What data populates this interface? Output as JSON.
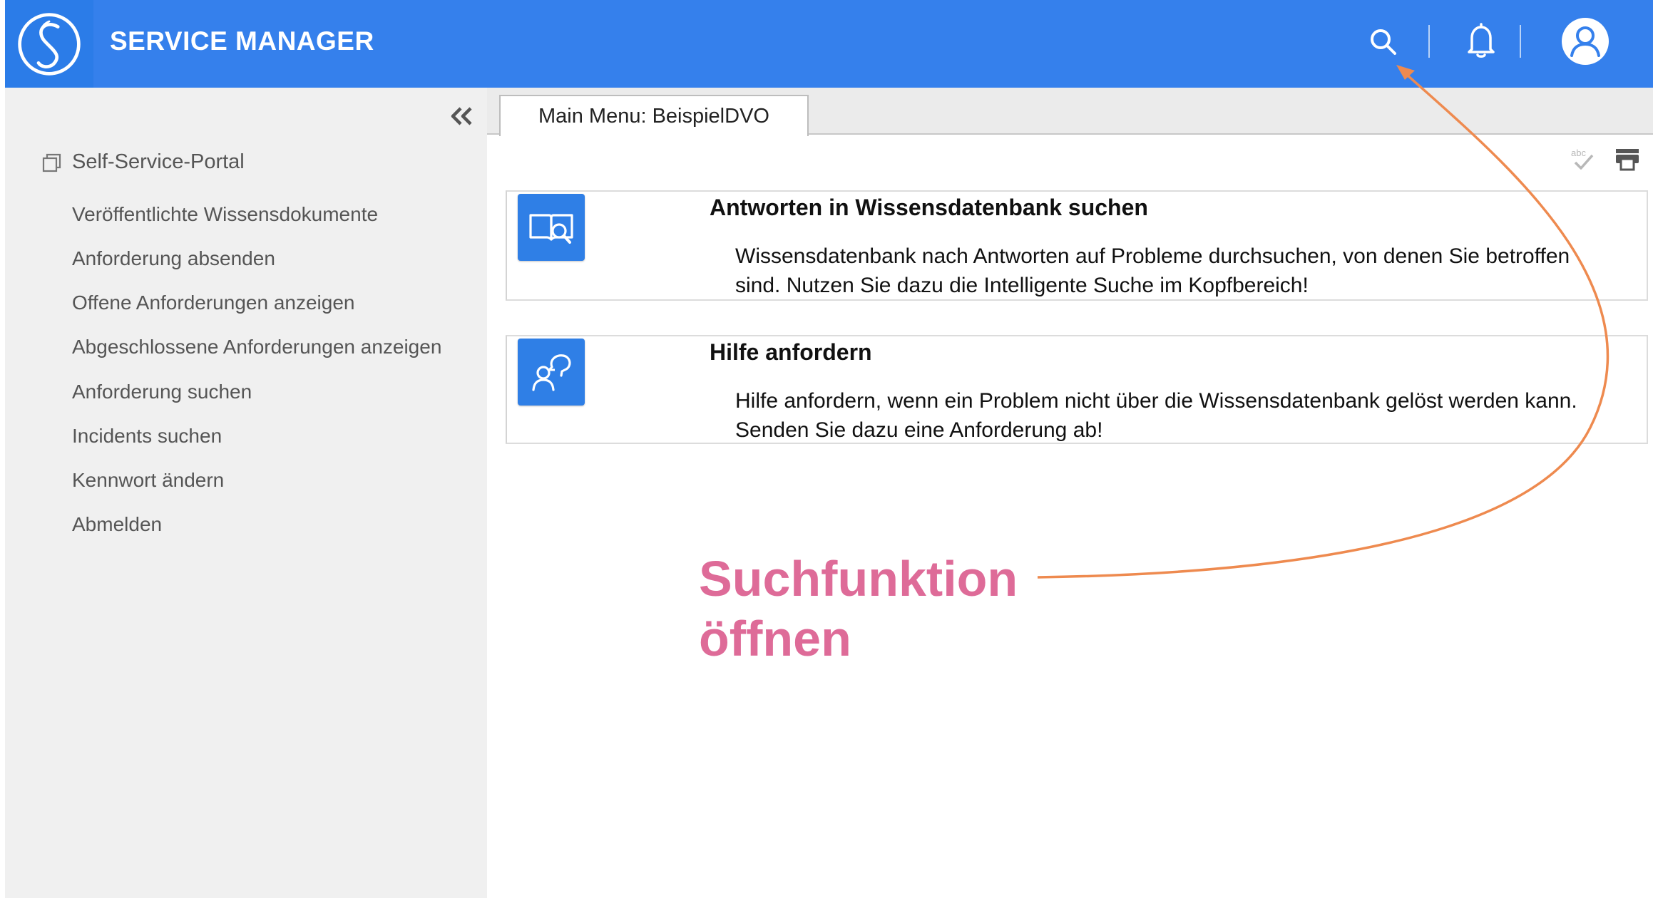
{
  "header": {
    "app_title": "SERVICE MANAGER",
    "logo_icon": "service-manager-logo",
    "icons": [
      "search-icon",
      "bell-icon",
      "user-icon"
    ],
    "background_color": "#3580ec"
  },
  "sidebar": {
    "collapse_icon": "double-chevron-left-icon",
    "portal_label": "Self-Service-Portal",
    "items": [
      {
        "label": "Veröffentlichte Wissensdokumente"
      },
      {
        "label": "Anforderung absenden"
      },
      {
        "label": "Offene Anforderungen anzeigen"
      },
      {
        "label": "Abgeschlossene Anforderungen anzeigen"
      },
      {
        "label": "Anforderung suchen"
      },
      {
        "label": "Incidents suchen"
      },
      {
        "label": "Kennwort ändern"
      },
      {
        "label": "Abmelden"
      }
    ]
  },
  "main": {
    "tab_label": "Main Menu: BeispielDVO",
    "toolbar_icons": [
      "spellcheck-icon",
      "print-icon"
    ],
    "cards": [
      {
        "icon": "knowledge-search-icon",
        "title": "Antworten in Wissensdatenbank suchen",
        "description": "Wissensdatenbank nach Antworten auf Probleme durchsuchen, von denen Sie betroffen sind. Nutzen Sie dazu die Intelligente Suche im Kopfbereich!"
      },
      {
        "icon": "request-help-icon",
        "title": "Hilfe anfordern",
        "description": "Hilfe anfordern, wenn ein Problem nicht über die Wissensdatenbank gelöst werden kann. Senden Sie dazu eine Anforderung ab!"
      }
    ]
  },
  "annotation": {
    "line1": "Suchfunktion",
    "line2": "öffnen",
    "text_color": "#de6b98",
    "arrow_color": "#ee8a4f"
  }
}
